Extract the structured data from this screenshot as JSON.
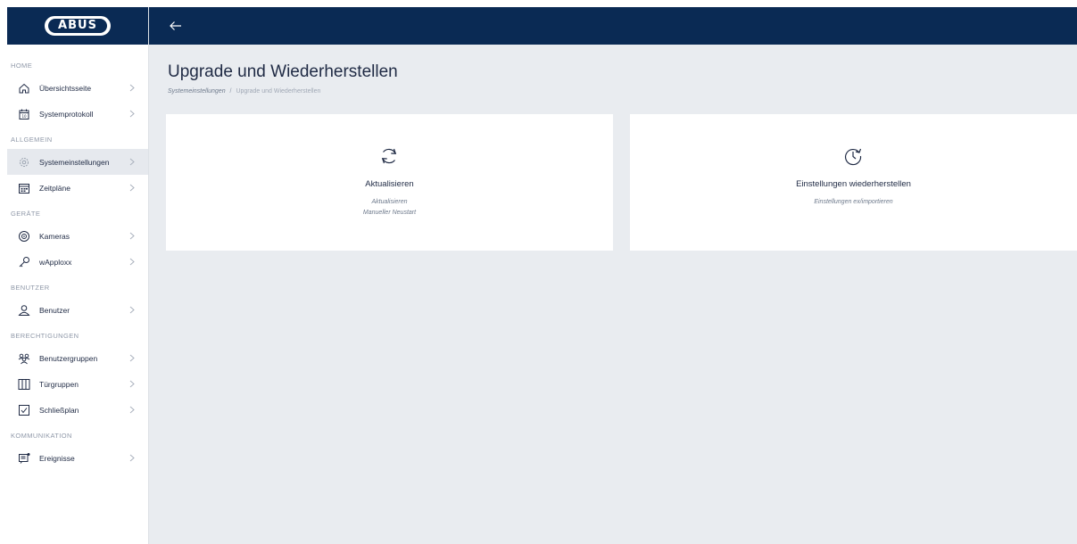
{
  "brand": {
    "logo_text": "ABUS"
  },
  "sidebar": {
    "sections": [
      {
        "label": "HOME",
        "items": [
          {
            "label": "Übersichtsseite",
            "icon": "home-icon"
          },
          {
            "label": "Systemprotokoll",
            "icon": "calendar-log-icon"
          }
        ]
      },
      {
        "label": "ALLGEMEIN",
        "items": [
          {
            "label": "Systemeinstellungen",
            "icon": "gear-icon"
          },
          {
            "label": "Zeitpläne",
            "icon": "schedule-icon"
          }
        ]
      },
      {
        "label": "GERÄTE",
        "items": [
          {
            "label": "Kameras",
            "icon": "camera-icon"
          },
          {
            "label": "wApploxx",
            "icon": "key-icon"
          }
        ]
      },
      {
        "label": "BENUTZER",
        "items": [
          {
            "label": "Benutzer",
            "icon": "user-icon"
          }
        ]
      },
      {
        "label": "BERECHTIGUNGEN",
        "items": [
          {
            "label": "Benutzergruppen",
            "icon": "user-group-icon"
          },
          {
            "label": "Türgruppen",
            "icon": "door-group-icon"
          },
          {
            "label": "Schließplan",
            "icon": "checkbox-icon"
          }
        ]
      },
      {
        "label": "KOMMUNIKATION",
        "items": [
          {
            "label": "Ereignisse",
            "icon": "event-message-icon"
          }
        ]
      }
    ]
  },
  "header": {
    "title": "Upgrade und Wiederherstellen",
    "breadcrumb": {
      "parent": "Systemeinstellungen",
      "separator": "/",
      "current": "Upgrade und Wiederherstellen"
    }
  },
  "cards": {
    "update": {
      "title": "Aktualisieren",
      "line1": "Aktualisieren",
      "line2": "Manueller Neustart",
      "icon": "refresh-icon"
    },
    "restore": {
      "title": "Einstellungen wiederherstellen",
      "line1": "Einstellungen ex/importieren",
      "icon": "history-icon"
    }
  },
  "colors": {
    "primary": "#0a2a54",
    "background": "#e9ecf0",
    "card": "#ffffff"
  }
}
